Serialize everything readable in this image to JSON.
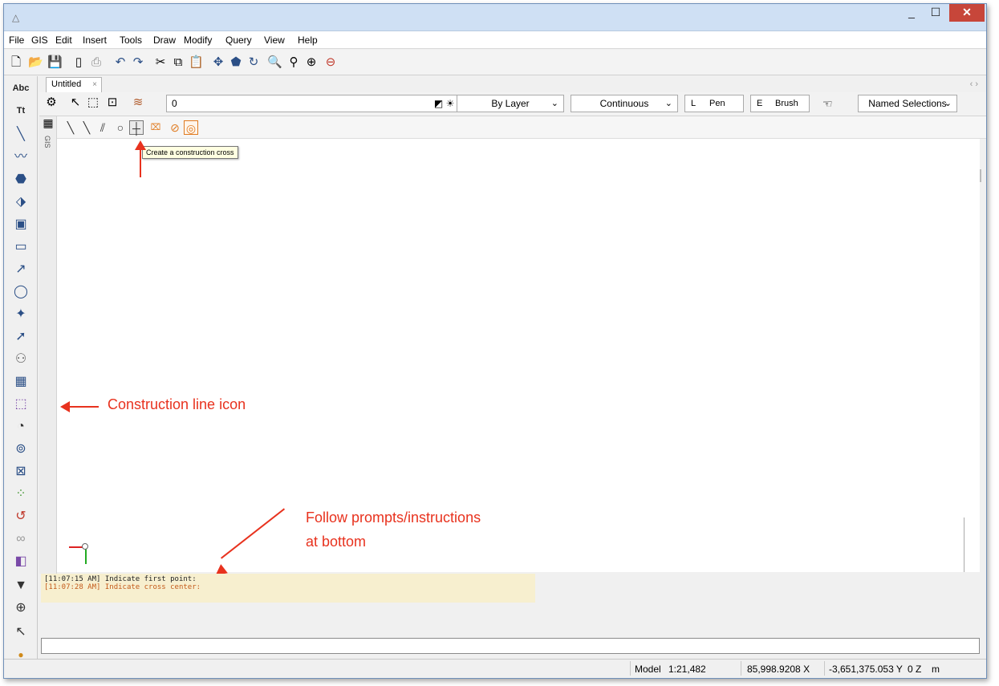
{
  "window": {
    "title_icon": "app-logo-icon"
  },
  "menu": [
    "File",
    "GIS",
    "Edit",
    "Insert",
    "Tools",
    "Draw",
    "Modify",
    "Query",
    "View",
    "Help"
  ],
  "tab": {
    "label": "Untitled",
    "close": "×",
    "nav": "‹ ›"
  },
  "props": {
    "layer_value": "0",
    "color": "By Layer",
    "linetype": "Continuous",
    "pen_key": "L",
    "pen_label": "Pen",
    "brush_key": "E",
    "brush_label": "Brush",
    "named_selections": "Named Selections"
  },
  "gis_label": "GIS",
  "left_toolbar": {
    "text_label_1": "Abc",
    "text_label_2": "Tt"
  },
  "tooltip": "Create a construction cross",
  "annotations": {
    "construction_line": "Construction line icon",
    "follow_prompts_1": "Follow prompts/instructions",
    "follow_prompts_2": "at bottom"
  },
  "prompt": {
    "line1": "[11:07:15 AM] Indicate first point:",
    "line2": "[11:07:28 AM] Indicate cross center:"
  },
  "status": {
    "mode": "Model",
    "scale": "1:21,482",
    "x": "85,998.9208 X",
    "y": "-3,651,375.053 Y",
    "z": "0 Z",
    "unit": "m"
  },
  "colors": {
    "accent": "#e8321e",
    "close": "#c7463a",
    "prompt_bg": "#f7efcf"
  }
}
